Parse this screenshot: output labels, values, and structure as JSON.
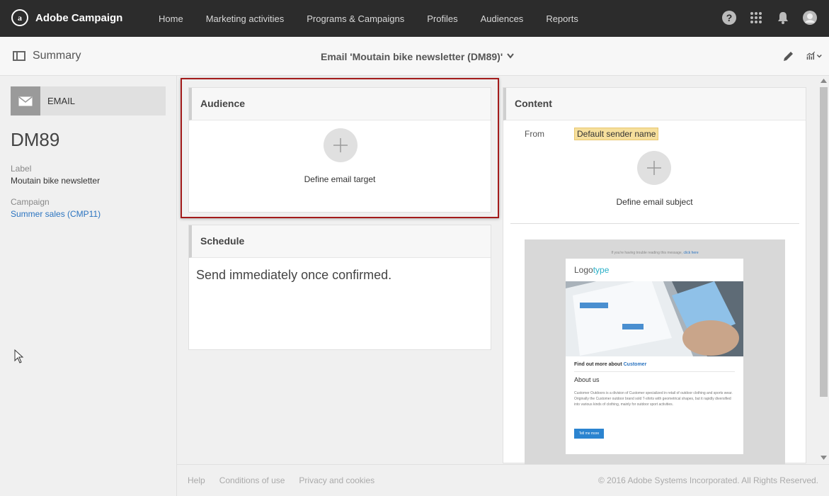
{
  "app": {
    "name": "Adobe Campaign",
    "logo_letter": "a"
  },
  "nav": {
    "items": [
      {
        "label": "Home"
      },
      {
        "label": "Marketing activities"
      },
      {
        "label": "Programs & Campaigns"
      },
      {
        "label": "Profiles"
      },
      {
        "label": "Audiences"
      },
      {
        "label": "Reports"
      }
    ]
  },
  "top_icons": [
    "help-icon",
    "apps-grid-icon",
    "bell-icon",
    "user-avatar-icon"
  ],
  "subheader": {
    "summary_label": "Summary",
    "title": "Email 'Moutain bike newsletter (DM89)'"
  },
  "sidebar": {
    "type_label": "EMAIL",
    "code": "DM89",
    "label_title": "Label",
    "label_value": "Moutain bike newsletter",
    "campaign_title": "Campaign",
    "campaign_value": "Summer sales (CMP11)"
  },
  "audience": {
    "title": "Audience",
    "action": "Define email target"
  },
  "schedule": {
    "title": "Schedule",
    "text": "Send immediately once confirmed."
  },
  "content": {
    "title": "Content",
    "from_label": "From",
    "sender": "Default sender name",
    "subject_action": "Define email subject"
  },
  "preview": {
    "top_text": "If you're having trouble reading this message,",
    "top_link": "click here",
    "logo_a": "Logo",
    "logo_b": "type",
    "find_text": "Find out more about",
    "find_brand": "Customer",
    "about_title": "About us",
    "about_text": "Customer Outdoors is a division of Customer specialized in retail of outdoor clothing and sports wear. Originally the Customer outdoor brand sold T-shirts with geometrical shapes, but it rapidly diversified into various kinds of clothing, mainly for outdoor sport activities.",
    "button": "Tell me more"
  },
  "footer": {
    "help": "Help",
    "conditions": "Conditions of use",
    "privacy": "Privacy and cookies",
    "copyright": "© 2016 Adobe Systems Incorporated. All Rights Reserved."
  },
  "colors": {
    "topbar": "#2c2c2c",
    "highlight": "#a31b1b",
    "link": "#2b74c0",
    "sender_bg": "#f6df9c"
  }
}
